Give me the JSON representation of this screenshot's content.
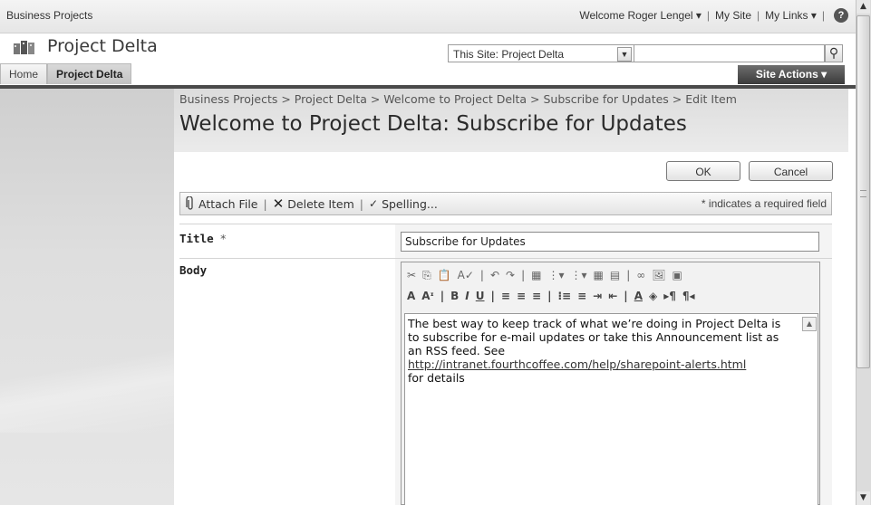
{
  "topbar": {
    "site_name": "Business Projects",
    "welcome": "Welcome Roger Lengel ▾",
    "my_site": "My Site",
    "my_links": "My Links ▾",
    "help_glyph": "?"
  },
  "header": {
    "title": "Project Delta",
    "tabs": [
      {
        "label": "Home"
      },
      {
        "label": "Project Delta"
      }
    ],
    "search_scope": "This Site: Project Delta",
    "search_value": "",
    "site_actions": "Site Actions ▾"
  },
  "breadcrumb": "Business Projects > Project Delta > Welcome to Project Delta > Subscribe for Updates > Edit Item",
  "page_title": "Welcome to Project Delta: Subscribe for Updates",
  "buttons": {
    "ok": "OK",
    "cancel": "Cancel"
  },
  "toolbar": {
    "attach": "Attach File",
    "delete": "Delete Item",
    "spelling": "Spelling...",
    "required_note": "* indicates a required field",
    "sep": "|"
  },
  "form": {
    "title_label": "Title",
    "required_star": "*",
    "title_value": "Subscribe for Updates",
    "body_label": "Body",
    "body_text": "The best way to keep track of what we’re doing in Project Delta is to subscribe for e-mail updates or take this Announcement list as an RSS feed. See",
    "body_link": "http://intranet.fourthcoffee.com/help/sharepoint-alerts.html",
    "body_tail": "for details"
  },
  "rte_toolbar": {
    "row1": [
      "✂",
      "⎘",
      "📋",
      "A✓",
      "|",
      "↶",
      "↷",
      "|",
      "▦",
      "⋮▾",
      "⋮▾",
      "▦",
      "▤",
      "|",
      "∞",
      "🖼",
      "▣"
    ],
    "row2": [
      "A",
      "Aᶦ",
      "|",
      "B",
      "I",
      "U",
      "|",
      "≡",
      "≡",
      "≡",
      "|",
      "⁝≡",
      "≡",
      "⇥",
      "⇤",
      "|",
      "A",
      "◈",
      "▸¶",
      "¶◂"
    ]
  },
  "colors": {
    "site_actions_bg": "#4a4a4a",
    "band": "#4a4a4a"
  }
}
